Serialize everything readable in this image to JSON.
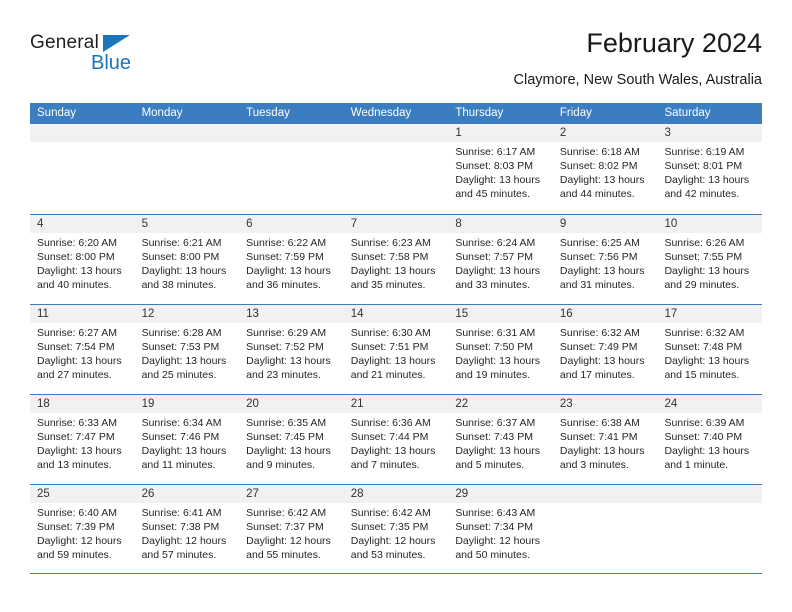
{
  "brand": {
    "name_top": "General",
    "name_bottom": "Blue",
    "triangle_color": "#1b75bb"
  },
  "header": {
    "title": "February 2024",
    "subtitle": "Claymore, New South Wales, Australia"
  },
  "colors": {
    "header_blue": "#3a7dc0",
    "daynum_band": "#f1f1f1",
    "text": "#262626"
  },
  "weekdays": [
    "Sunday",
    "Monday",
    "Tuesday",
    "Wednesday",
    "Thursday",
    "Friday",
    "Saturday"
  ],
  "weeks": [
    [
      {
        "day": "",
        "empty": true
      },
      {
        "day": "",
        "empty": true
      },
      {
        "day": "",
        "empty": true
      },
      {
        "day": "",
        "empty": true
      },
      {
        "day": "1",
        "sunrise": "Sunrise: 6:17 AM",
        "sunset": "Sunset: 8:03 PM",
        "daylight1": "Daylight: 13 hours",
        "daylight2": "and 45 minutes."
      },
      {
        "day": "2",
        "sunrise": "Sunrise: 6:18 AM",
        "sunset": "Sunset: 8:02 PM",
        "daylight1": "Daylight: 13 hours",
        "daylight2": "and 44 minutes."
      },
      {
        "day": "3",
        "sunrise": "Sunrise: 6:19 AM",
        "sunset": "Sunset: 8:01 PM",
        "daylight1": "Daylight: 13 hours",
        "daylight2": "and 42 minutes."
      }
    ],
    [
      {
        "day": "4",
        "sunrise": "Sunrise: 6:20 AM",
        "sunset": "Sunset: 8:00 PM",
        "daylight1": "Daylight: 13 hours",
        "daylight2": "and 40 minutes."
      },
      {
        "day": "5",
        "sunrise": "Sunrise: 6:21 AM",
        "sunset": "Sunset: 8:00 PM",
        "daylight1": "Daylight: 13 hours",
        "daylight2": "and 38 minutes."
      },
      {
        "day": "6",
        "sunrise": "Sunrise: 6:22 AM",
        "sunset": "Sunset: 7:59 PM",
        "daylight1": "Daylight: 13 hours",
        "daylight2": "and 36 minutes."
      },
      {
        "day": "7",
        "sunrise": "Sunrise: 6:23 AM",
        "sunset": "Sunset: 7:58 PM",
        "daylight1": "Daylight: 13 hours",
        "daylight2": "and 35 minutes."
      },
      {
        "day": "8",
        "sunrise": "Sunrise: 6:24 AM",
        "sunset": "Sunset: 7:57 PM",
        "daylight1": "Daylight: 13 hours",
        "daylight2": "and 33 minutes."
      },
      {
        "day": "9",
        "sunrise": "Sunrise: 6:25 AM",
        "sunset": "Sunset: 7:56 PM",
        "daylight1": "Daylight: 13 hours",
        "daylight2": "and 31 minutes."
      },
      {
        "day": "10",
        "sunrise": "Sunrise: 6:26 AM",
        "sunset": "Sunset: 7:55 PM",
        "daylight1": "Daylight: 13 hours",
        "daylight2": "and 29 minutes."
      }
    ],
    [
      {
        "day": "11",
        "sunrise": "Sunrise: 6:27 AM",
        "sunset": "Sunset: 7:54 PM",
        "daylight1": "Daylight: 13 hours",
        "daylight2": "and 27 minutes."
      },
      {
        "day": "12",
        "sunrise": "Sunrise: 6:28 AM",
        "sunset": "Sunset: 7:53 PM",
        "daylight1": "Daylight: 13 hours",
        "daylight2": "and 25 minutes."
      },
      {
        "day": "13",
        "sunrise": "Sunrise: 6:29 AM",
        "sunset": "Sunset: 7:52 PM",
        "daylight1": "Daylight: 13 hours",
        "daylight2": "and 23 minutes."
      },
      {
        "day": "14",
        "sunrise": "Sunrise: 6:30 AM",
        "sunset": "Sunset: 7:51 PM",
        "daylight1": "Daylight: 13 hours",
        "daylight2": "and 21 minutes."
      },
      {
        "day": "15",
        "sunrise": "Sunrise: 6:31 AM",
        "sunset": "Sunset: 7:50 PM",
        "daylight1": "Daylight: 13 hours",
        "daylight2": "and 19 minutes."
      },
      {
        "day": "16",
        "sunrise": "Sunrise: 6:32 AM",
        "sunset": "Sunset: 7:49 PM",
        "daylight1": "Daylight: 13 hours",
        "daylight2": "and 17 minutes."
      },
      {
        "day": "17",
        "sunrise": "Sunrise: 6:32 AM",
        "sunset": "Sunset: 7:48 PM",
        "daylight1": "Daylight: 13 hours",
        "daylight2": "and 15 minutes."
      }
    ],
    [
      {
        "day": "18",
        "sunrise": "Sunrise: 6:33 AM",
        "sunset": "Sunset: 7:47 PM",
        "daylight1": "Daylight: 13 hours",
        "daylight2": "and 13 minutes."
      },
      {
        "day": "19",
        "sunrise": "Sunrise: 6:34 AM",
        "sunset": "Sunset: 7:46 PM",
        "daylight1": "Daylight: 13 hours",
        "daylight2": "and 11 minutes."
      },
      {
        "day": "20",
        "sunrise": "Sunrise: 6:35 AM",
        "sunset": "Sunset: 7:45 PM",
        "daylight1": "Daylight: 13 hours",
        "daylight2": "and 9 minutes."
      },
      {
        "day": "21",
        "sunrise": "Sunrise: 6:36 AM",
        "sunset": "Sunset: 7:44 PM",
        "daylight1": "Daylight: 13 hours",
        "daylight2": "and 7 minutes."
      },
      {
        "day": "22",
        "sunrise": "Sunrise: 6:37 AM",
        "sunset": "Sunset: 7:43 PM",
        "daylight1": "Daylight: 13 hours",
        "daylight2": "and 5 minutes."
      },
      {
        "day": "23",
        "sunrise": "Sunrise: 6:38 AM",
        "sunset": "Sunset: 7:41 PM",
        "daylight1": "Daylight: 13 hours",
        "daylight2": "and 3 minutes."
      },
      {
        "day": "24",
        "sunrise": "Sunrise: 6:39 AM",
        "sunset": "Sunset: 7:40 PM",
        "daylight1": "Daylight: 13 hours",
        "daylight2": "and 1 minute."
      }
    ],
    [
      {
        "day": "25",
        "sunrise": "Sunrise: 6:40 AM",
        "sunset": "Sunset: 7:39 PM",
        "daylight1": "Daylight: 12 hours",
        "daylight2": "and 59 minutes."
      },
      {
        "day": "26",
        "sunrise": "Sunrise: 6:41 AM",
        "sunset": "Sunset: 7:38 PM",
        "daylight1": "Daylight: 12 hours",
        "daylight2": "and 57 minutes."
      },
      {
        "day": "27",
        "sunrise": "Sunrise: 6:42 AM",
        "sunset": "Sunset: 7:37 PM",
        "daylight1": "Daylight: 12 hours",
        "daylight2": "and 55 minutes."
      },
      {
        "day": "28",
        "sunrise": "Sunrise: 6:42 AM",
        "sunset": "Sunset: 7:35 PM",
        "daylight1": "Daylight: 12 hours",
        "daylight2": "and 53 minutes."
      },
      {
        "day": "29",
        "sunrise": "Sunrise: 6:43 AM",
        "sunset": "Sunset: 7:34 PM",
        "daylight1": "Daylight: 12 hours",
        "daylight2": "and 50 minutes."
      },
      {
        "day": "",
        "empty": true
      },
      {
        "day": "",
        "empty": true
      }
    ]
  ]
}
